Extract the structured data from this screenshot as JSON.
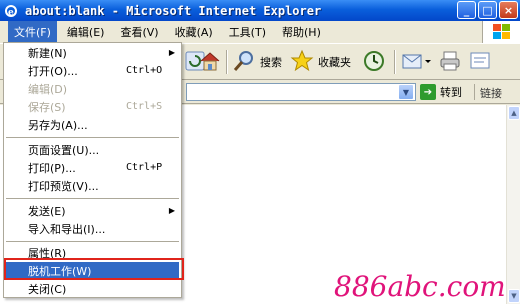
{
  "window": {
    "title": "about:blank - Microsoft Internet Explorer",
    "buttons": {
      "minimize": "_",
      "maximize": "□",
      "close": "×"
    }
  },
  "menubar": {
    "items": [
      {
        "label": "文件(F)",
        "active": true
      },
      {
        "label": "编辑(E)"
      },
      {
        "label": "查看(V)"
      },
      {
        "label": "收藏(A)"
      },
      {
        "label": "工具(T)"
      },
      {
        "label": "帮助(H)"
      }
    ]
  },
  "toolbar": {
    "search_label": "搜索",
    "favorites_label": "收藏夹"
  },
  "address": {
    "go_label": "转到",
    "links_label": "链接"
  },
  "file_menu": {
    "items": [
      {
        "label": "新建(N)",
        "submenu": "▶"
      },
      {
        "label": "打开(O)...",
        "shortcut": "Ctrl+O"
      },
      {
        "label": "编辑(D)",
        "disabled": true
      },
      {
        "label": "保存(S)",
        "shortcut": "Ctrl+S",
        "disabled": true
      },
      {
        "label": "另存为(A)..."
      },
      {
        "label": "页面设置(U)..."
      },
      {
        "label": "打印(P)...",
        "shortcut": "Ctrl+P"
      },
      {
        "label": "打印预览(V)..."
      },
      {
        "label": "发送(E)",
        "submenu": "▶"
      },
      {
        "label": "导入和导出(I)..."
      },
      {
        "label": "属性(R)"
      },
      {
        "label": "脱机工作(W)",
        "highlighted": true
      },
      {
        "label": "关闭(C)"
      }
    ]
  },
  "watermark": "886abc.com",
  "colors": {
    "title_bar": "#0a5fdc",
    "highlight": "#316ac5",
    "red_box": "#e0241b",
    "watermark": "#e0137a"
  }
}
